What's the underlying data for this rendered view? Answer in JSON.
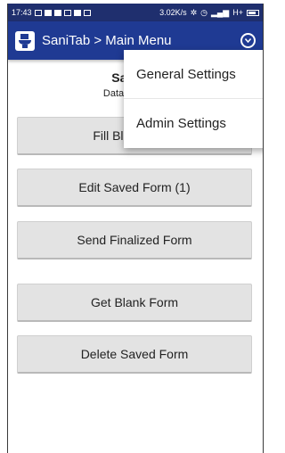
{
  "status": {
    "time": "17:43",
    "net_speed": "3.02K/s",
    "signal": "H+"
  },
  "appbar": {
    "title": "SaniTab > Main Menu"
  },
  "header": {
    "title": "SaniTab",
    "subtitle": "Data collection"
  },
  "buttons": {
    "fill_blank": "Fill Blank Form",
    "edit_saved": "Edit Saved Form (1)",
    "send_finalized": "Send Finalized Form",
    "get_blank": "Get Blank Form",
    "delete_saved": "Delete Saved Form"
  },
  "menu": {
    "items": [
      {
        "label": "General Settings"
      },
      {
        "label": "Admin Settings"
      }
    ]
  },
  "colors": {
    "statusbar": "#1f2f6e",
    "appbar": "#1f3a93",
    "button": "#e3e3e3"
  }
}
